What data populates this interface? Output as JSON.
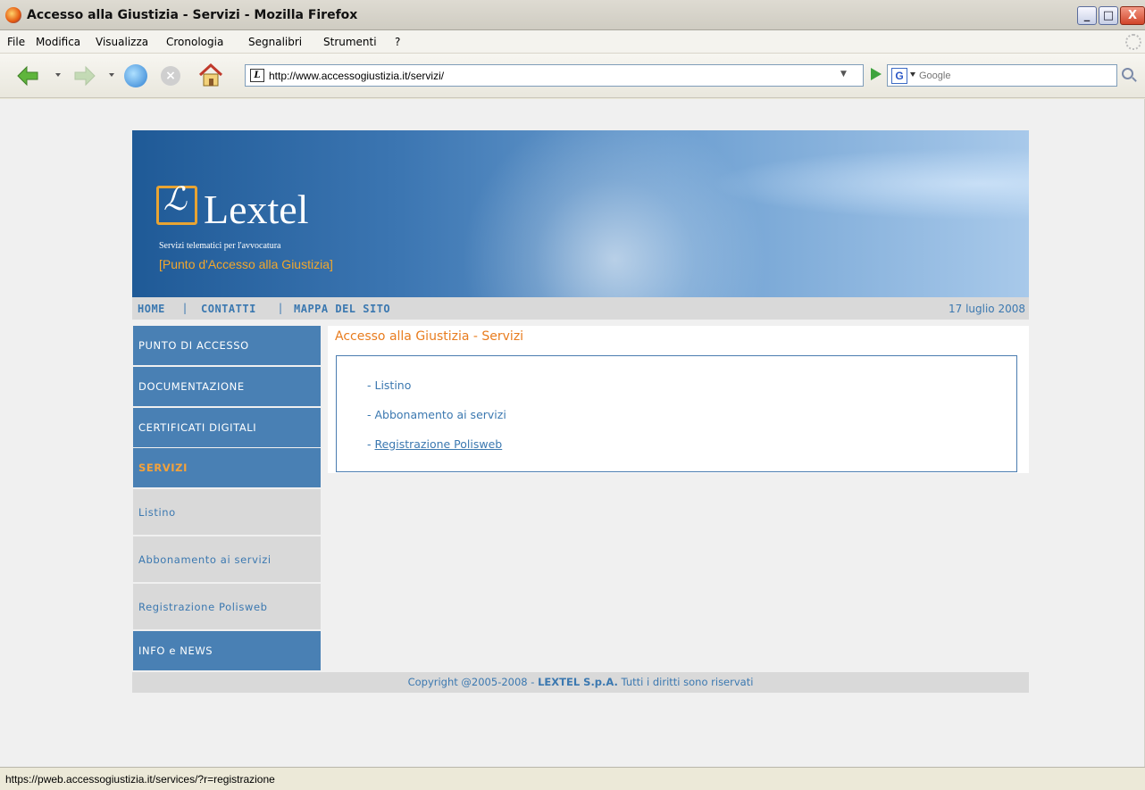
{
  "window": {
    "title": "Accesso alla Giustizia - Servizi - Mozilla Firefox",
    "minimize": "_",
    "maximize": "□",
    "close": "X"
  },
  "menubar": [
    "File",
    "Modifica",
    "Visualizza",
    "Cronologia",
    "Segnalibri",
    "Strumenti",
    "?"
  ],
  "navbar": {
    "url": "http://www.accessogiustizia.it/servizi/",
    "search_placeholder": "Google",
    "stop_glyph": "×"
  },
  "site": {
    "logo_name": "Lextel",
    "logo_tagline": "Servizi telematici per l'avvocatura",
    "logo_sub": "[Punto d'Accesso alla Giustizia]",
    "topnav": [
      "HOME",
      "CONTATTI",
      "MAPPA DEL SITO"
    ],
    "topnav_sep": "|",
    "date": "17 luglio 2008",
    "sidebar": [
      {
        "label": "PUNTO DI ACCESSO",
        "kind": "main"
      },
      {
        "label": "DOCUMENTAZIONE",
        "kind": "main"
      },
      {
        "label": "CERTIFICATI DIGITALI",
        "kind": "main"
      },
      {
        "label": "SERVIZI",
        "kind": "active"
      },
      {
        "label": "Listino",
        "kind": "sub"
      },
      {
        "label": "Abbonamento ai servizi",
        "kind": "sub"
      },
      {
        "label": "Registrazione Polisweb",
        "kind": "sub"
      },
      {
        "label": "INFO e NEWS",
        "kind": "main"
      }
    ],
    "content_title": "Accesso alla Giustizia - Servizi",
    "content_links": [
      "- Listino",
      "- Abbonamento ai servizi",
      "Registrazione Polisweb"
    ],
    "content_link_prefix": "- ",
    "footer": {
      "prefix": "Copyright @2005-2008 - ",
      "company": "LEXTEL S.p.A.",
      "suffix": " Tutti i diritti sono riservati"
    }
  },
  "statusbar": "https://pweb.accessogiustizia.it/services/?r=registrazione",
  "colors": {
    "sidebar_main": "#4980b4",
    "link_blue": "#3b78b0",
    "accent_orange": "#e87c1e"
  }
}
